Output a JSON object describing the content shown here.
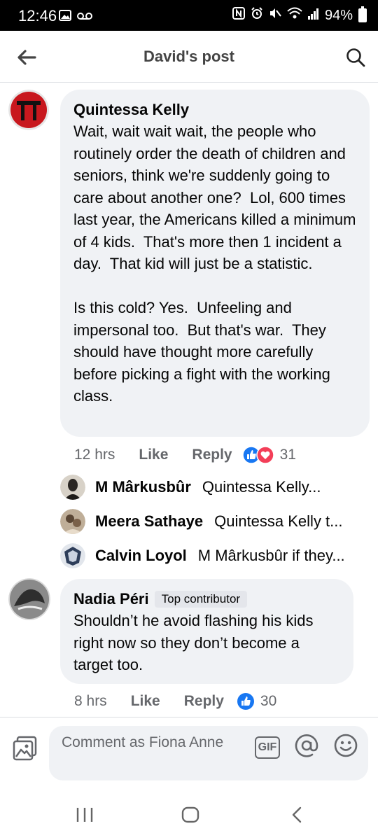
{
  "status_bar": {
    "time": "12:46",
    "battery": "94%"
  },
  "header": {
    "title": "David's post"
  },
  "comments": [
    {
      "author": "Quintessa Kelly",
      "text": "Wait, wait wait wait, the people who routinely order the death of children and seniors, think we're suddenly going to care about another one?  Lol, 600 times last year, the Americans killed a minimum of 4 kids.  That's more then 1 incident a day.  That kid will just be a statistic.\n\nIs this cold? Yes.  Unfeeling and impersonal too.  But that's war.  They should have thought more carefully before picking a fight with the working class.",
      "time": "12 hrs",
      "like_label": "Like",
      "reply_label": "Reply",
      "reaction_count": "31",
      "reactions": [
        "like-icon",
        "love-icon"
      ],
      "replies": [
        {
          "author": "M Mârkusbûr",
          "preview": "Quintessa Kelly..."
        },
        {
          "author": "Meera Sathaye",
          "preview": "Quintessa Kelly t..."
        },
        {
          "author": "Calvin Loyol",
          "preview": "M Mârkusbûr if they..."
        }
      ]
    },
    {
      "author": "Nadia Péri",
      "badge": "Top contributor",
      "text": "Shouldn’t he avoid flashing his kids right now so they don’t become a target too.",
      "time": "8 hrs",
      "like_label": "Like",
      "reply_label": "Reply",
      "reaction_count": "30",
      "reactions": [
        "like-icon"
      ]
    }
  ],
  "composer": {
    "placeholder": "Comment as Fiona Anne",
    "gif_label": "GIF"
  },
  "colors": {
    "accent": "#1877f2",
    "love": "#f33e58",
    "bubble": "#f0f2f5",
    "meta": "#65676b"
  }
}
